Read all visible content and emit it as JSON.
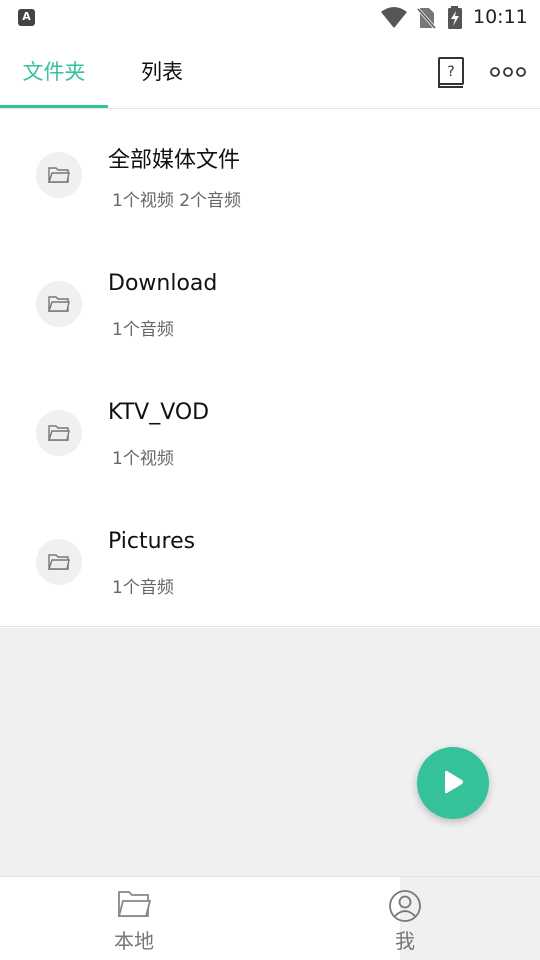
{
  "status_bar": {
    "left_icon_letter": "A",
    "time": "10:11"
  },
  "tabs": [
    {
      "label": "文件夹",
      "selected": true
    },
    {
      "label": "列表",
      "selected": false
    }
  ],
  "toolbar": {
    "help_icon": "help-book-icon",
    "more_icon": "more-dots-icon"
  },
  "folders": [
    {
      "name": "全部媒体文件",
      "count": "1个视频 2个音频"
    },
    {
      "name": "Download",
      "count": "1个音频"
    },
    {
      "name": "KTV_VOD",
      "count": "1个视频"
    },
    {
      "name": "Pictures",
      "count": "1个音频"
    }
  ],
  "fab": {
    "icon": "play-icon"
  },
  "bottom_nav": [
    {
      "label": "本地",
      "icon": "folder-icon"
    },
    {
      "label": "我",
      "icon": "user-icon"
    }
  ],
  "colors": {
    "accent": "#35c29b",
    "text_primary": "#111111",
    "text_secondary": "#666666",
    "background_grey": "#f0f0f0"
  }
}
